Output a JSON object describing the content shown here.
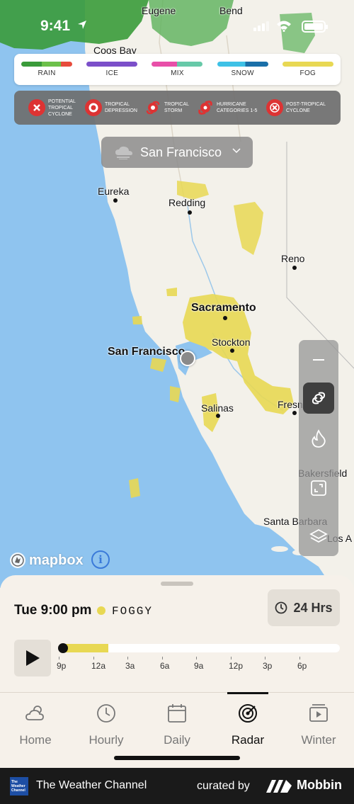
{
  "status_bar": {
    "time": "9:41"
  },
  "precip_legend": [
    {
      "label": "RAIN",
      "colors": [
        "#3a9b3a",
        "#6cc04a",
        "#e74c3c"
      ]
    },
    {
      "label": "ICE",
      "colors": [
        "#7b4fc9"
      ]
    },
    {
      "label": "MIX",
      "colors": [
        "#e84fa8",
        "#67c9a8"
      ]
    },
    {
      "label": "SNOW",
      "colors": [
        "#3ec1e6",
        "#1a6fa8"
      ]
    },
    {
      "label": "FOG",
      "colors": [
        "#e8d853"
      ]
    }
  ],
  "storm_legend": [
    {
      "label": "POTENTIAL TROPICAL CYCLONE",
      "icon": "x-circle-icon"
    },
    {
      "label": "TROPICAL DEPRESSION",
      "icon": "ring-icon"
    },
    {
      "label": "TROPICAL STORM",
      "icon": "storm-icon"
    },
    {
      "label": "HURRICANE CATEGORIES 1-5",
      "icon": "hurricane-icon"
    },
    {
      "label": "POST-TROPICAL CYCLONE",
      "icon": "x-ring-icon"
    }
  ],
  "location": {
    "name": "San Francisco"
  },
  "map": {
    "cities": {
      "eugene": "Eugene",
      "bend": "Bend",
      "coos_bay": "Coos Bay",
      "eureka": "Eureka",
      "redding": "Redding",
      "reno": "Reno",
      "sacramento": "Sacramento",
      "stockton": "Stockton",
      "san_francisco": "San Francisco",
      "salinas": "Salinas",
      "fresno": "Fresn",
      "bakersfield": "Bakersfield",
      "santa_barbara": "Santa Barbara",
      "los_angeles": "Los A"
    },
    "attribution": "mapbox",
    "info_label": "i"
  },
  "timeline": {
    "datetime": "Tue 9:00 pm",
    "condition": "FOGGY",
    "range_label": "24 Hrs",
    "progress": 0.17,
    "ticks": [
      "9p",
      "12a",
      "3a",
      "6a",
      "9a",
      "12p",
      "3p",
      "6p"
    ]
  },
  "tabs": [
    {
      "label": "Home",
      "icon": "cloud-sun-icon",
      "active": false
    },
    {
      "label": "Hourly",
      "icon": "clock-icon",
      "active": false
    },
    {
      "label": "Daily",
      "icon": "calendar-icon",
      "active": false
    },
    {
      "label": "Radar",
      "icon": "radar-icon",
      "active": true
    },
    {
      "label": "Winter",
      "icon": "video-icon",
      "active": false
    }
  ],
  "footer": {
    "logo_text": "The Weather Channel",
    "app_name": "The Weather Channel",
    "curated": "curated by",
    "brand": "Mobbin"
  },
  "colors": {
    "ocean": "#8fc4ef",
    "land": "#f3f1ea",
    "fog": "#e8d853",
    "rain": "#3a9b3a"
  }
}
